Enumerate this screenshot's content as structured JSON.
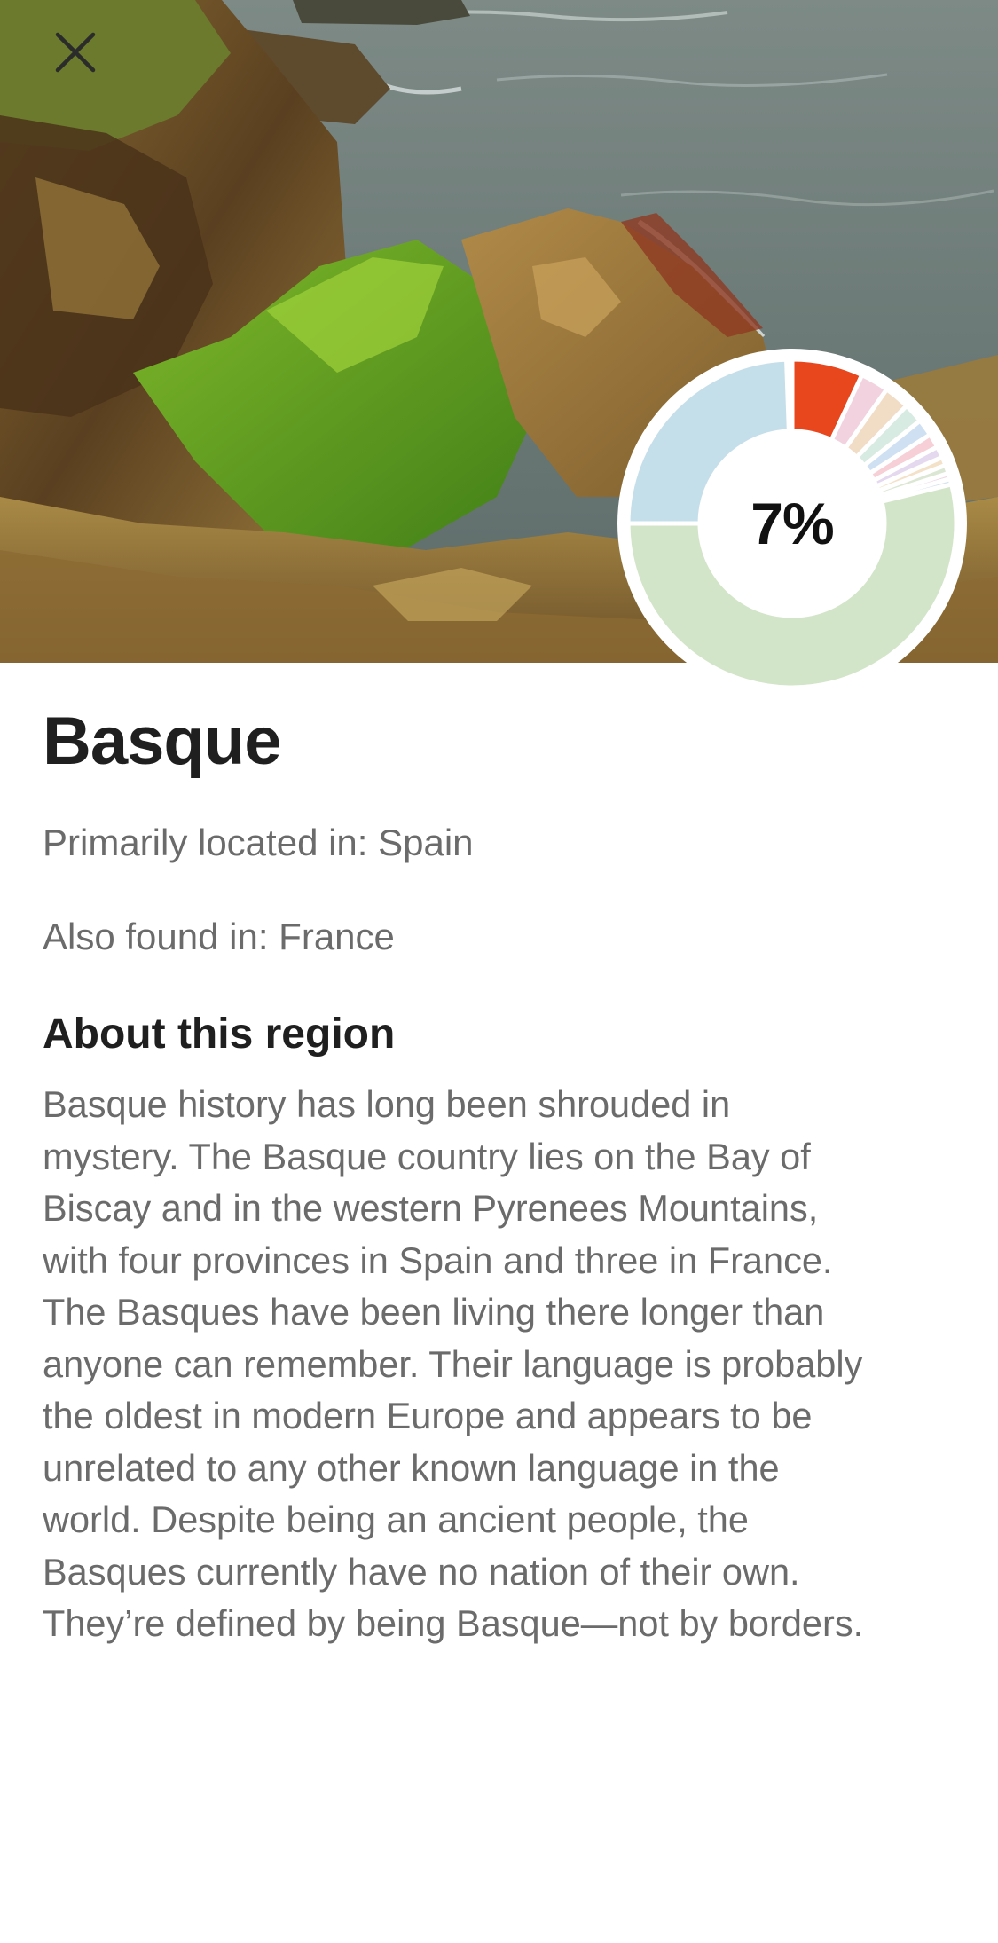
{
  "header": {
    "close_icon": "close-icon"
  },
  "hero": {
    "image_description_icon": "coastal-cliff-photo"
  },
  "ring_chart": {
    "percent_label": "7%",
    "highlight_value": 0.07,
    "colors": {
      "highlight": "#e8461d",
      "large_green": "#d3e5c9",
      "large_blue": "#c5dfea"
    }
  },
  "region": {
    "title": "Basque",
    "primarily_located": "Primarily located in: Spain",
    "also_found": "Also found in: France",
    "about_heading": "About this region",
    "about_lines": [
      "Basque history has long been shrouded in",
      "mystery. The Basque country lies on the Bay of",
      "Biscay and in the western Pyrenees Mountains,",
      "with four provinces in Spain and three in France.",
      "The Basques have been living there longer than",
      "anyone can remember. Their language is probably",
      "the oldest in modern Europe and appears to be",
      "unrelated to any other known language in the",
      "world. Despite being an ancient people, the",
      "Basques currently have no nation of their own.",
      "They’re defined by being Basque—not by borders."
    ]
  }
}
